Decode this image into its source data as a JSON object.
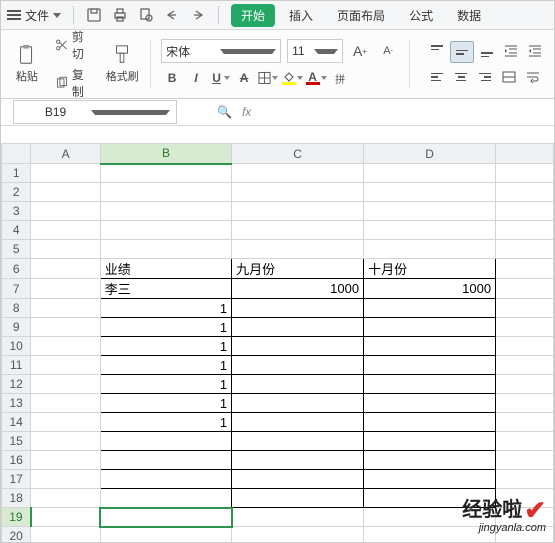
{
  "titlebar": {
    "file_label": "文件"
  },
  "tabs": {
    "start": "开始",
    "insert": "插入",
    "layout": "页面布局",
    "formula": "公式",
    "data": "数据"
  },
  "ribbon": {
    "paste": "粘贴",
    "cut": "剪切",
    "copy": "复制",
    "format_painter": "格式刷",
    "font_name": "宋体",
    "font_size": "11",
    "bold": "B",
    "italic": "I",
    "underline": "U",
    "strike": "S",
    "font_a_big": "A",
    "font_a_small": "A",
    "fill_color": "#ffff00",
    "font_color": "#cc0000"
  },
  "namebox": {
    "ref": "B19"
  },
  "columns": [
    "A",
    "B",
    "C",
    "D"
  ],
  "rows": [
    1,
    2,
    3,
    4,
    5,
    6,
    7,
    8,
    9,
    10,
    11,
    12,
    13,
    14,
    15,
    16,
    17,
    18,
    19,
    20
  ],
  "cells": {
    "B6": "业绩",
    "C6": "九月份",
    "D6": "十月份",
    "B7": "李三",
    "C7": "1000",
    "D7": "1000",
    "B8": "1",
    "B9": "1",
    "B10": "1",
    "B11": "1",
    "B12": "1",
    "B13": "1",
    "B14": "1"
  },
  "active_cell": "B19",
  "watermark": {
    "line1": "经验啦",
    "line2": "jingyanla.com"
  }
}
